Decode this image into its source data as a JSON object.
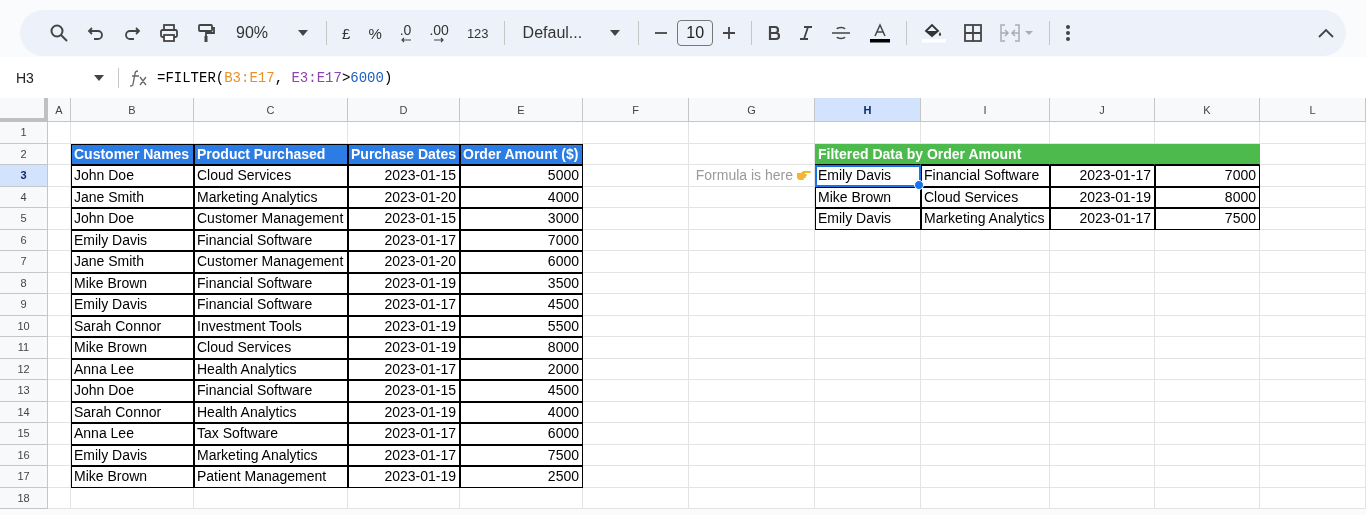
{
  "toolbar": {
    "zoom": "90%",
    "currency": "£",
    "percent": "%",
    "decrease_decimals": ".0",
    "increase_decimals": ".00",
    "number_format": "123",
    "font": "Defaul...",
    "font_size": "10",
    "merge_cells": {
      "disabled": true
    }
  },
  "name_box": "H3",
  "formula": [
    {
      "text": "=FILTER("
    },
    {
      "text": "B3:E17",
      "color": "#e8912d"
    },
    {
      "text": ", "
    },
    {
      "text": "E3:E17",
      "color": "#8e44ad"
    },
    {
      "text": ">"
    },
    {
      "text": "6000",
      "color": "#1f5fbf"
    },
    {
      "text": ")"
    }
  ],
  "columns": [
    {
      "label": "A",
      "selected": false
    },
    {
      "label": "B",
      "selected": false
    },
    {
      "label": "C",
      "selected": false
    },
    {
      "label": "D",
      "selected": false
    },
    {
      "label": "E",
      "selected": false
    },
    {
      "label": "F",
      "selected": false
    },
    {
      "label": "G",
      "selected": false
    },
    {
      "label": "H",
      "selected": true
    },
    {
      "label": "I",
      "selected": false
    },
    {
      "label": "J",
      "selected": false
    },
    {
      "label": "K",
      "selected": false
    },
    {
      "label": "L",
      "selected": false
    }
  ],
  "rows": [
    {
      "number": "1",
      "selected": false
    },
    {
      "number": "2",
      "selected": false,
      "cells": {
        "B": {
          "kind": "header",
          "text": "Customer Names",
          "selected": false
        },
        "C": {
          "kind": "header",
          "text": "Product Purchased",
          "selected": false
        },
        "D": {
          "kind": "header",
          "text": "Purchase Dates",
          "selected": false
        },
        "E": {
          "kind": "header",
          "text": "Order Amount ($)",
          "selected": false
        },
        "H": {
          "kind": "green_header",
          "text": "Filtered Data by Order Amount",
          "selected": false
        },
        "I": {
          "kind": "green_header",
          "selected": false
        },
        "J": {
          "kind": "green_header",
          "selected": false
        },
        "K": {
          "kind": "green_header",
          "selected": false
        }
      }
    },
    {
      "number": "3",
      "selected": true,
      "cells": {
        "B": {
          "kind": "text",
          "text": "John Doe",
          "selected": false
        },
        "C": {
          "kind": "text",
          "text": "Cloud Services",
          "selected": false
        },
        "D": {
          "kind": "number",
          "text": "2023-01-15",
          "selected": false
        },
        "E": {
          "kind": "number",
          "text": "5000",
          "selected": false
        },
        "G": {
          "kind": "note",
          "text": "Formula is here",
          "selected": false
        },
        "H": {
          "kind": "text",
          "text": "Emily Davis",
          "selected": true
        },
        "I": {
          "kind": "text",
          "text": "Financial Software",
          "selected": false
        },
        "J": {
          "kind": "number",
          "text": "2023-01-17",
          "selected": false
        },
        "K": {
          "kind": "number",
          "text": "7000",
          "selected": false
        }
      }
    },
    {
      "number": "4",
      "selected": false,
      "cells": {
        "B": {
          "kind": "text",
          "text": "Jane Smith",
          "selected": false
        },
        "C": {
          "kind": "text",
          "text": "Marketing Analytics",
          "selected": false
        },
        "D": {
          "kind": "number",
          "text": "2023-01-20",
          "selected": false
        },
        "E": {
          "kind": "number",
          "text": "4000",
          "selected": false
        },
        "H": {
          "kind": "text",
          "text": "Mike Brown",
          "selected": false
        },
        "I": {
          "kind": "text",
          "text": "Cloud Services",
          "selected": false
        },
        "J": {
          "kind": "number",
          "text": "2023-01-19",
          "selected": false
        },
        "K": {
          "kind": "number",
          "text": "8000",
          "selected": false
        }
      }
    },
    {
      "number": "5",
      "selected": false,
      "cells": {
        "B": {
          "kind": "text",
          "text": "John Doe",
          "selected": false
        },
        "C": {
          "kind": "text",
          "text": "Customer Management",
          "selected": false
        },
        "D": {
          "kind": "number",
          "text": "2023-01-15",
          "selected": false
        },
        "E": {
          "kind": "number",
          "text": "3000",
          "selected": false
        },
        "H": {
          "kind": "text",
          "text": "Emily Davis",
          "selected": false
        },
        "I": {
          "kind": "text",
          "text": "Marketing Analytics",
          "selected": false
        },
        "J": {
          "kind": "number",
          "text": "2023-01-17",
          "selected": false
        },
        "K": {
          "kind": "number",
          "text": "7500",
          "selected": false
        }
      }
    },
    {
      "number": "6",
      "selected": false,
      "cells": {
        "B": {
          "kind": "text",
          "text": "Emily Davis",
          "selected": false
        },
        "C": {
          "kind": "text",
          "text": "Financial Software",
          "selected": false
        },
        "D": {
          "kind": "number",
          "text": "2023-01-17",
          "selected": false
        },
        "E": {
          "kind": "number",
          "text": "7000",
          "selected": false
        }
      }
    },
    {
      "number": "7",
      "selected": false,
      "cells": {
        "B": {
          "kind": "text",
          "text": "Jane Smith",
          "selected": false
        },
        "C": {
          "kind": "text",
          "text": "Customer Management",
          "selected": false
        },
        "D": {
          "kind": "number",
          "text": "2023-01-20",
          "selected": false
        },
        "E": {
          "kind": "number",
          "text": "6000",
          "selected": false
        }
      }
    },
    {
      "number": "8",
      "selected": false,
      "cells": {
        "B": {
          "kind": "text",
          "text": "Mike Brown",
          "selected": false
        },
        "C": {
          "kind": "text",
          "text": "Financial Software",
          "selected": false
        },
        "D": {
          "kind": "number",
          "text": "2023-01-19",
          "selected": false
        },
        "E": {
          "kind": "number",
          "text": "3500",
          "selected": false
        }
      }
    },
    {
      "number": "9",
      "selected": false,
      "cells": {
        "B": {
          "kind": "text",
          "text": "Emily Davis",
          "selected": false
        },
        "C": {
          "kind": "text",
          "text": "Financial Software",
          "selected": false
        },
        "D": {
          "kind": "number",
          "text": "2023-01-17",
          "selected": false
        },
        "E": {
          "kind": "number",
          "text": "4500",
          "selected": false
        }
      }
    },
    {
      "number": "10",
      "selected": false,
      "cells": {
        "B": {
          "kind": "text",
          "text": "Sarah Connor",
          "selected": false
        },
        "C": {
          "kind": "text",
          "text": "Investment Tools",
          "selected": false
        },
        "D": {
          "kind": "number",
          "text": "2023-01-19",
          "selected": false
        },
        "E": {
          "kind": "number",
          "text": "5500",
          "selected": false
        }
      }
    },
    {
      "number": "11",
      "selected": false,
      "cells": {
        "B": {
          "kind": "text",
          "text": "Mike Brown",
          "selected": false
        },
        "C": {
          "kind": "text",
          "text": "Cloud Services",
          "selected": false
        },
        "D": {
          "kind": "number",
          "text": "2023-01-19",
          "selected": false
        },
        "E": {
          "kind": "number",
          "text": "8000",
          "selected": false
        }
      }
    },
    {
      "number": "12",
      "selected": false,
      "cells": {
        "B": {
          "kind": "text",
          "text": "Anna Lee",
          "selected": false
        },
        "C": {
          "kind": "text",
          "text": "Health Analytics",
          "selected": false
        },
        "D": {
          "kind": "number",
          "text": "2023-01-17",
          "selected": false
        },
        "E": {
          "kind": "number",
          "text": "2000",
          "selected": false
        }
      }
    },
    {
      "number": "13",
      "selected": false,
      "cells": {
        "B": {
          "kind": "text",
          "text": "John Doe",
          "selected": false
        },
        "C": {
          "kind": "text",
          "text": "Financial Software",
          "selected": false
        },
        "D": {
          "kind": "number",
          "text": "2023-01-15",
          "selected": false
        },
        "E": {
          "kind": "number",
          "text": "4500",
          "selected": false
        }
      }
    },
    {
      "number": "14",
      "selected": false,
      "cells": {
        "B": {
          "kind": "text",
          "text": "Sarah Connor",
          "selected": false
        },
        "C": {
          "kind": "text",
          "text": "Health Analytics",
          "selected": false
        },
        "D": {
          "kind": "number",
          "text": "2023-01-19",
          "selected": false
        },
        "E": {
          "kind": "number",
          "text": "4000",
          "selected": false
        }
      }
    },
    {
      "number": "15",
      "selected": false,
      "cells": {
        "B": {
          "kind": "text",
          "text": "Anna Lee",
          "selected": false
        },
        "C": {
          "kind": "text",
          "text": "Tax Software",
          "selected": false
        },
        "D": {
          "kind": "number",
          "text": "2023-01-17",
          "selected": false
        },
        "E": {
          "kind": "number",
          "text": "6000",
          "selected": false
        }
      }
    },
    {
      "number": "16",
      "selected": false,
      "cells": {
        "B": {
          "kind": "text",
          "text": "Emily Davis",
          "selected": false
        },
        "C": {
          "kind": "text",
          "text": "Marketing Analytics",
          "selected": false
        },
        "D": {
          "kind": "number",
          "text": "2023-01-17",
          "selected": false
        },
        "E": {
          "kind": "number",
          "text": "7500",
          "selected": false
        }
      }
    },
    {
      "number": "17",
      "selected": false,
      "cells": {
        "B": {
          "kind": "text",
          "text": "Mike Brown",
          "selected": false
        },
        "C": {
          "kind": "text",
          "text": "Patient Management",
          "selected": false
        },
        "D": {
          "kind": "number",
          "text": "2023-01-19",
          "selected": false
        },
        "E": {
          "kind": "number",
          "text": "2500",
          "selected": false
        }
      }
    },
    {
      "number": "18",
      "selected": false
    }
  ]
}
